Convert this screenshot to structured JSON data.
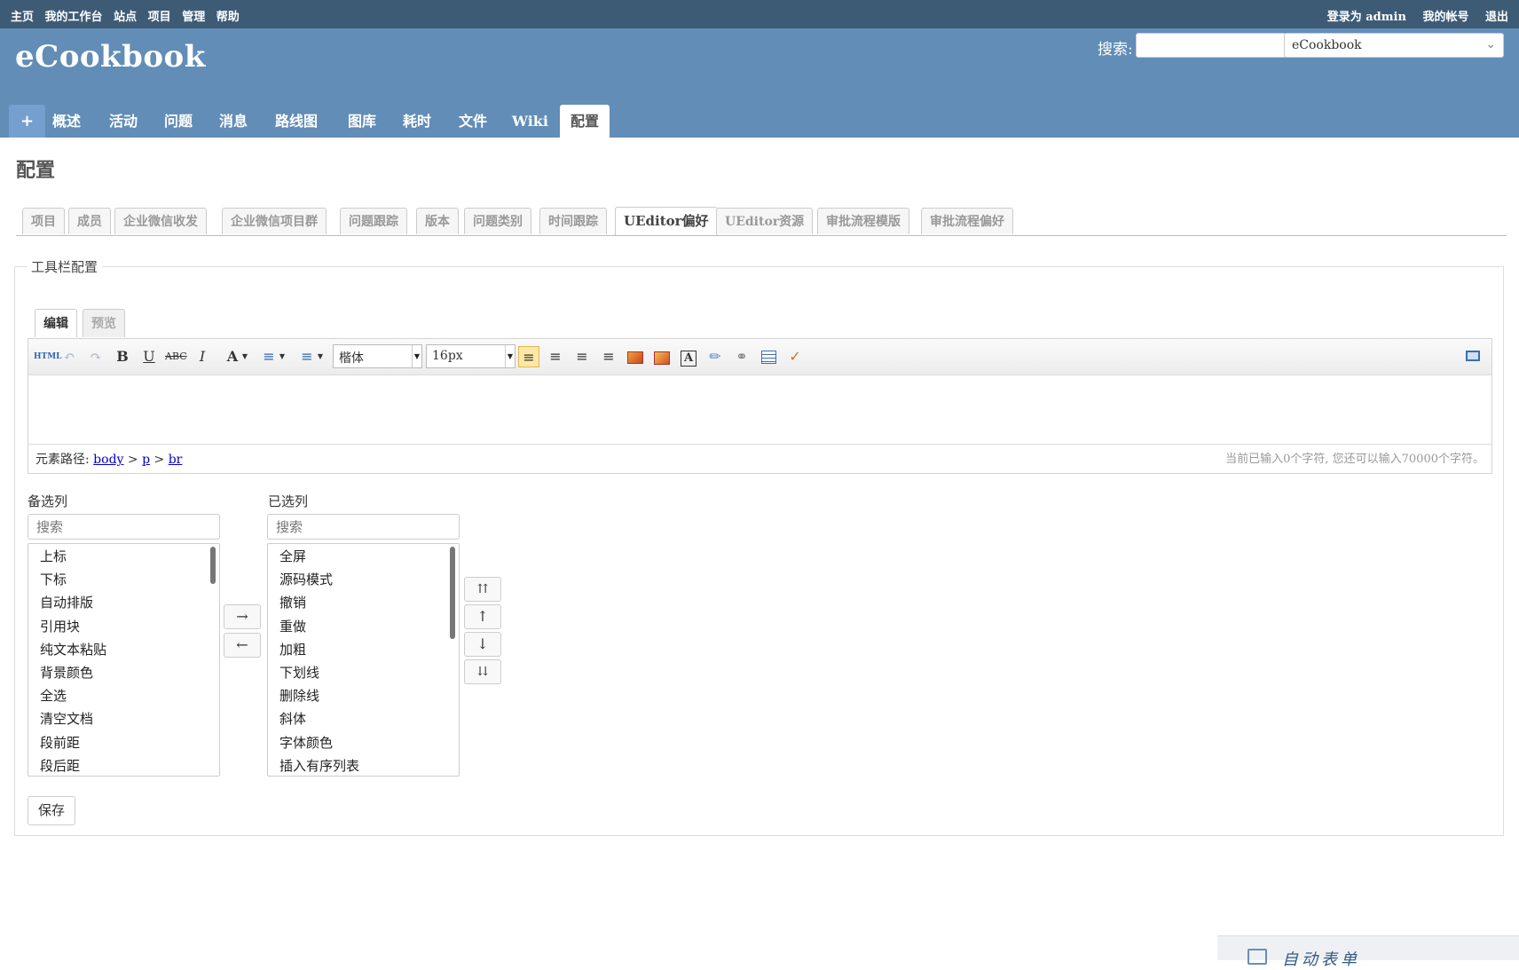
{
  "top_menu": {
    "left": [
      "主页",
      "我的工作台",
      "站点",
      "项目",
      "管理",
      "帮助"
    ],
    "logged_in_prefix": "登录为",
    "user": "admin",
    "account": "我的帐号",
    "logout": "退出"
  },
  "header": {
    "title": "eCookbook",
    "search_label": "搜索:",
    "search_value": "",
    "project_select": "eCookbook"
  },
  "main_tabs": [
    "+",
    "概述",
    "活动",
    "问题",
    "消息",
    "路线图",
    "图库",
    "耗时",
    "文件",
    "Wiki",
    "配置"
  ],
  "main_tabs_active": "配置",
  "page": {
    "title": "配置"
  },
  "settings_tabs": [
    "项目",
    "成员",
    "企业微信收发",
    "企业微信项目群",
    "问题跟踪",
    "版本",
    "问题类别",
    "时间跟踪",
    "UEditor偏好",
    "UEditor资源",
    "审批流程模版",
    "审批流程偏好"
  ],
  "settings_tabs_active": "UEditor偏好",
  "toolbar_config": {
    "legend": "工具栏配置",
    "editor_tabs": {
      "edit": "编辑",
      "preview": "预览"
    },
    "font_family": "楷体",
    "font_size": "16px",
    "source_label": "HTML",
    "status": {
      "path_label": "元素路径:",
      "path": [
        "body",
        "p",
        "br"
      ],
      "count": "当前已输入0个字符, 您还可以输入70000个字符。"
    }
  },
  "lists": {
    "available_label": "备选列",
    "selected_label": "已选列",
    "search_placeholder": "搜索",
    "available": [
      "上标",
      "下标",
      "自动排版",
      "引用块",
      "纯文本粘贴",
      "背景颜色",
      "全选",
      "清空文档",
      "段前距",
      "段后距"
    ],
    "selected": [
      "全屏",
      "源码模式",
      "撤销",
      "重做",
      "加粗",
      "下划线",
      "删除线",
      "斜体",
      "字体颜色",
      "插入有序列表"
    ],
    "add_arrow": "→",
    "remove_arrow": "←",
    "move_top": "⇈",
    "move_up": "↑",
    "move_down": "↓",
    "move_bottom": "⇊"
  },
  "save_label": "保存",
  "floating_panel": {
    "label": "自动表单"
  }
}
